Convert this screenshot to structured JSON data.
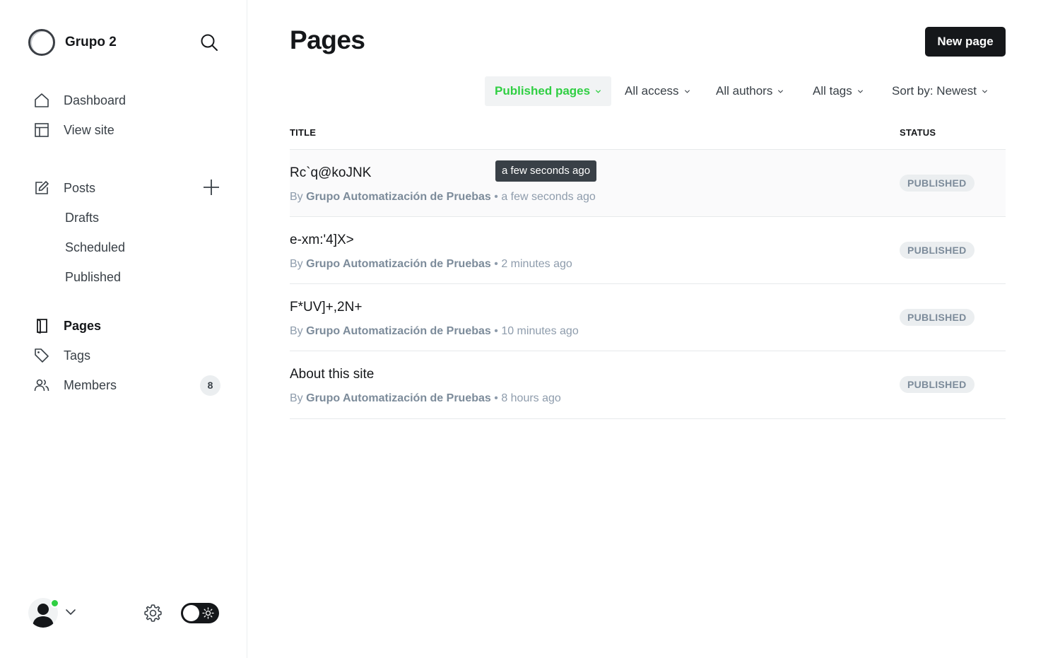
{
  "sidebar": {
    "brand_name": "Grupo 2",
    "nav": {
      "dashboard": "Dashboard",
      "view_site": "View site",
      "posts": "Posts",
      "drafts": "Drafts",
      "scheduled": "Scheduled",
      "published": "Published",
      "pages": "Pages",
      "tags": "Tags",
      "members": "Members",
      "members_count": "8"
    },
    "icons": [
      "search-icon",
      "home-icon",
      "layout-icon",
      "edit-icon",
      "plus-icon",
      "page-icon",
      "tag-icon",
      "members-icon",
      "avatar-icon",
      "chevron-down-icon",
      "gear-icon",
      "sun-icon"
    ]
  },
  "main": {
    "title": "Pages",
    "new_page_label": "New page",
    "filters": {
      "type": "Published pages",
      "access": "All access",
      "authors": "All authors",
      "tags": "All tags",
      "sort": "Sort by: Newest"
    },
    "table": {
      "col_title": "TITLE",
      "col_status": "STATUS",
      "rows": [
        {
          "title": "Rc`q@koJNK",
          "by": "By",
          "author": "Grupo Automatización de Pruebas",
          "time": "a few seconds ago",
          "status": "PUBLISHED"
        },
        {
          "title": "e-xm:'4]X>",
          "by": "By",
          "author": "Grupo Automatización de Pruebas",
          "time": "2 minutes ago",
          "status": "PUBLISHED"
        },
        {
          "title": "F*UV]+,2N+",
          "by": "By",
          "author": "Grupo Automatización de Pruebas",
          "time": "10 minutes ago",
          "status": "PUBLISHED"
        },
        {
          "title": "About this site",
          "by": "By",
          "author": "Grupo Automatización de Pruebas",
          "time": "8 hours ago",
          "status": "PUBLISHED"
        }
      ]
    },
    "tooltip": "a few seconds ago",
    "separator": "•"
  },
  "colors": {
    "accent_green": "#30cf43",
    "text_dark": "#15171a",
    "muted": "#8e9cac"
  }
}
